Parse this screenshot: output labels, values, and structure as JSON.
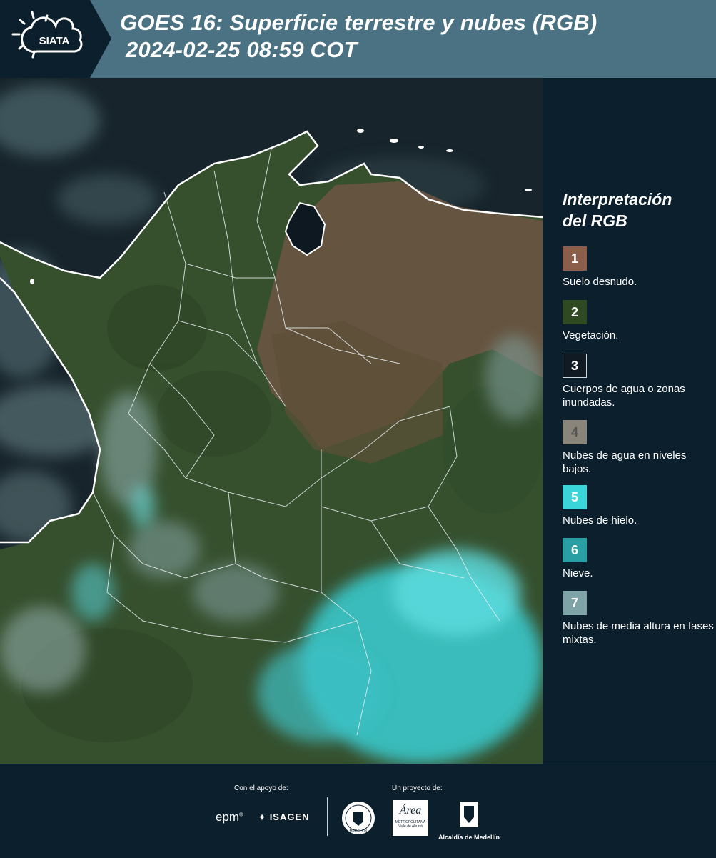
{
  "header": {
    "logo_text": "SIATA",
    "title_line1": "GOES 16: Superficie terrestre y nubes (RGB)",
    "title_line2": "2024-02-25 08:59 COT"
  },
  "legend": {
    "title_line1": "Interpretación",
    "title_line2": "del RGB",
    "items": [
      {
        "number": "1",
        "label": "Suelo desnudo.",
        "color": "#8b5e4b"
      },
      {
        "number": "2",
        "label": "Vegetación.",
        "color": "#2f4a22"
      },
      {
        "number": "3",
        "label": "Cuerpos de agua o zonas inundadas.",
        "color": "#101a22"
      },
      {
        "number": "4",
        "label": "Nubes de agua en niveles bajos.",
        "color": "#8a857b"
      },
      {
        "number": "5",
        "label": "Nubes de hielo.",
        "color": "#39d5d9"
      },
      {
        "number": "6",
        "label": "Nieve.",
        "color": "#2a9fa3"
      },
      {
        "number": "7",
        "label": "Nubes de media altura en fases mixtas.",
        "color": "#7ea4a7"
      }
    ]
  },
  "footer": {
    "support_label": "Con el apoyo de:",
    "project_label": "Un proyecto de:",
    "sponsor1": "epm",
    "sponsor2": "ISAGEN",
    "partner_area": "Área",
    "partner_area_sub": "METROPOLITANA",
    "partner_area_sub2": "Valle de Aburrá",
    "partner_alcaldia": "Alcaldía de Medellín",
    "partner_medellin_seal": "MEDELLÍN"
  },
  "colors": {
    "header_bg": "#4a7282",
    "logo_tab": "#0c1f2c",
    "panel_bg": "#0c1f2c",
    "ice_clouds": "#39d5d9"
  }
}
